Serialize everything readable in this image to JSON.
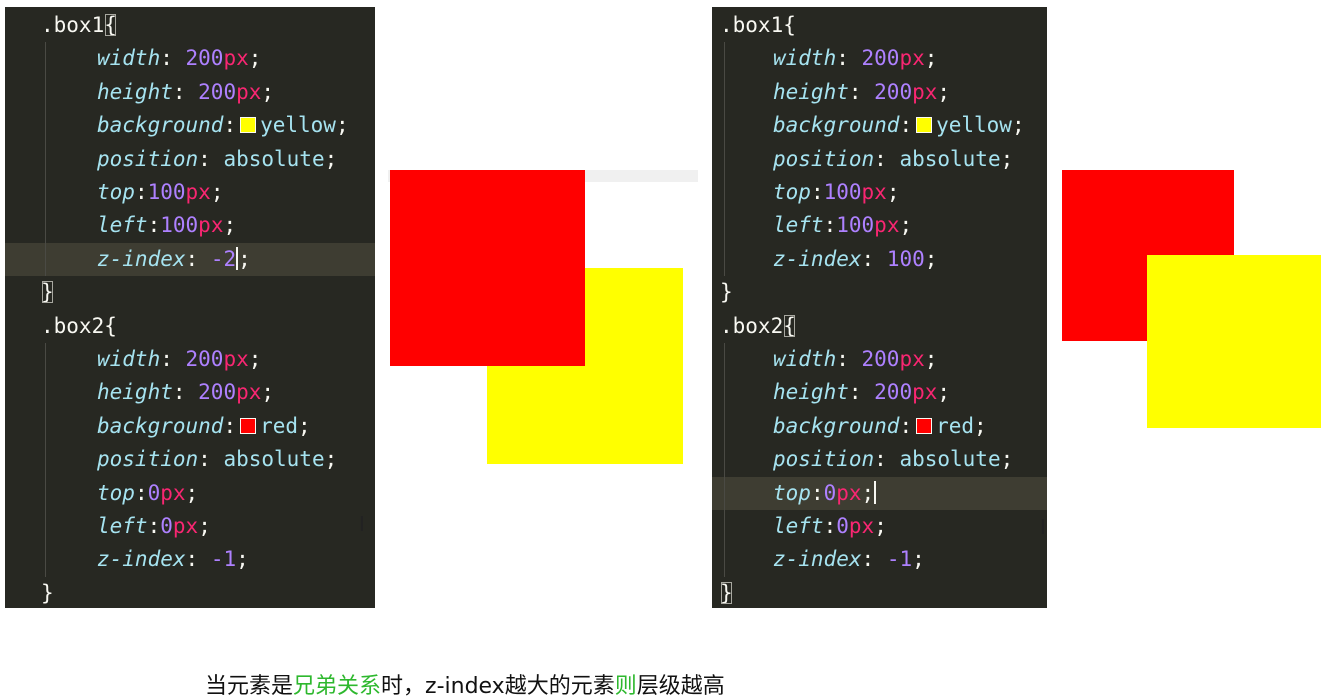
{
  "left_editor": {
    "lines": [
      {
        "kind": "selector",
        "sel": ".box1",
        "brace": "{",
        "match": true
      },
      {
        "kind": "decl",
        "prop": "width",
        "num": "200",
        "unit": "px"
      },
      {
        "kind": "decl",
        "prop": "height",
        "num": "200",
        "unit": "px"
      },
      {
        "kind": "color",
        "prop": "background",
        "swatch": "#ffff00",
        "value": "yellow"
      },
      {
        "kind": "word",
        "prop": "position",
        "value": "absolute"
      },
      {
        "kind": "decl",
        "prop": "top",
        "num": "100",
        "unit": "px",
        "tight": true
      },
      {
        "kind": "decl",
        "prop": "left",
        "num": "100",
        "unit": "px",
        "tight": true
      },
      {
        "kind": "decl",
        "prop": "z-index",
        "num": "-2",
        "unit": "",
        "cursor": true,
        "highlight": true
      },
      {
        "kind": "close",
        "brace": "}",
        "match": true
      },
      {
        "kind": "selector",
        "sel": ".box2",
        "brace": "{",
        "match": false
      },
      {
        "kind": "decl",
        "prop": "width",
        "num": "200",
        "unit": "px"
      },
      {
        "kind": "decl",
        "prop": "height",
        "num": "200",
        "unit": "px"
      },
      {
        "kind": "color",
        "prop": "background",
        "swatch": "#ff0000",
        "value": "red"
      },
      {
        "kind": "word",
        "prop": "position",
        "value": "absolute"
      },
      {
        "kind": "decl",
        "prop": "top",
        "num": "0",
        "unit": "px",
        "tight": true
      },
      {
        "kind": "decl",
        "prop": "left",
        "num": "0",
        "unit": "px",
        "tight": true
      },
      {
        "kind": "decl",
        "prop": "z-index",
        "num": "-1",
        "unit": ""
      },
      {
        "kind": "close",
        "brace": "}",
        "match": false
      }
    ]
  },
  "right_editor": {
    "lines": [
      {
        "kind": "selector",
        "sel": ".box1",
        "brace": "{",
        "match": false
      },
      {
        "kind": "decl",
        "prop": "width",
        "num": "200",
        "unit": "px"
      },
      {
        "kind": "decl",
        "prop": "height",
        "num": "200",
        "unit": "px"
      },
      {
        "kind": "color",
        "prop": "background",
        "swatch": "#ffff00",
        "value": "yellow"
      },
      {
        "kind": "word",
        "prop": "position",
        "value": "absolute"
      },
      {
        "kind": "decl",
        "prop": "top",
        "num": "100",
        "unit": "px",
        "tight": true
      },
      {
        "kind": "decl",
        "prop": "left",
        "num": "100",
        "unit": "px",
        "tight": true
      },
      {
        "kind": "decl",
        "prop": "z-index",
        "num": "100",
        "unit": ""
      },
      {
        "kind": "close",
        "brace": "}",
        "match": false
      },
      {
        "kind": "selector",
        "sel": ".box2",
        "brace": "{",
        "match": true
      },
      {
        "kind": "decl",
        "prop": "width",
        "num": "200",
        "unit": "px"
      },
      {
        "kind": "decl",
        "prop": "height",
        "num": "200",
        "unit": "px"
      },
      {
        "kind": "color",
        "prop": "background",
        "swatch": "#ff0000",
        "value": "red"
      },
      {
        "kind": "word",
        "prop": "position",
        "value": "absolute"
      },
      {
        "kind": "decl",
        "prop": "top",
        "num": "0",
        "unit": "px",
        "tight": true,
        "cursor": true,
        "highlight": true
      },
      {
        "kind": "decl",
        "prop": "left",
        "num": "0",
        "unit": "px",
        "tight": true
      },
      {
        "kind": "decl",
        "prop": "z-index",
        "num": "-1",
        "unit": ""
      },
      {
        "kind": "close",
        "brace": "}",
        "match": true
      }
    ]
  },
  "colors": {
    "red": "#ff0000",
    "yellow": "#ffff00",
    "editor_bg": "#272822",
    "accent_green": "#2eb82e"
  },
  "caption": {
    "part1": "当元素是",
    "part2": "兄弟关系",
    "part3": "时，z-index越大的元素",
    "part4": "则",
    "part5": "层级越高"
  }
}
